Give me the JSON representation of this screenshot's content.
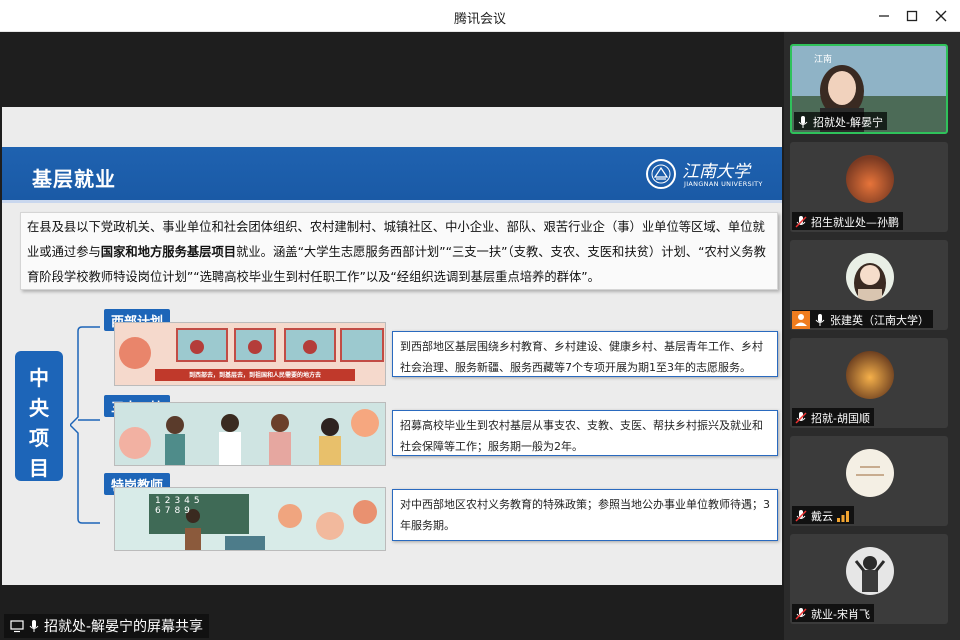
{
  "window": {
    "title": "腾讯会议",
    "minimize_icon": "minimize-icon",
    "maximize_icon": "maximize-icon",
    "close_icon": "close-icon"
  },
  "slide": {
    "header_title": "基层就业",
    "logo": {
      "cn": "江南大学",
      "en": "JIANGNAN UNIVERSITY"
    },
    "intro_part1": "在县及县以下党政机关、事业单位和社会团体组织、农村建制村、城镇社区、中小企业、部队、艰苦行业企（事）业单位等区域、单位就业或通过参与",
    "intro_bold": "国家和地方服务基层项目",
    "intro_part2": "就业。涵盖“大学生志愿服务西部计划”“三支一扶”（支教、支农、支医和扶贫）计划、“农村义务教育阶段学校教师特设岗位计划”“选聘高校毕业生到村任职工作”以及“经组织选调到基层重点培养的群体”。",
    "center_label": "中央项目",
    "projects": [
      {
        "tag": "西部计划",
        "banner": "到西部去，到基层去，到祖国和人民需要的地方去",
        "desc": "到西部地区基层围绕乡村教育、乡村建设、健康乡村、基层青年工作、乡村社会治理、服务新疆、服务西藏等7个专项开展为期1至3年的志愿服务。"
      },
      {
        "tag": "三支一扶",
        "desc": "招募高校毕业生到农村基层从事支农、支教、支医、帮扶乡村振兴及就业和社会保障等工作；服务期一般为2年。"
      },
      {
        "tag": "特岗教师",
        "desc": "对中西部地区农村义务教育的特殊政策；参照当地公办事业单位教师待遇；3年服务期。"
      }
    ]
  },
  "share_label": "招就处-解晏宁的屏幕共享",
  "participants": [
    {
      "name": "招就处-解晏宁",
      "mic": "mic-on",
      "active": true
    },
    {
      "name": "招生就业处—孙鹏",
      "mic": "mic-muted"
    },
    {
      "name": "张建英（江南大学）",
      "mic": "mic-on",
      "host": true
    },
    {
      "name": "招就-胡国顺",
      "mic": "mic-muted"
    },
    {
      "name": "戴云",
      "mic": "mic-muted",
      "speaking": true
    },
    {
      "name": "就业-宋肖飞",
      "mic": "mic-muted"
    }
  ],
  "colors": {
    "accent": "#1d65b8",
    "active_border": "#2fc25b",
    "speaking": "#f2a531"
  }
}
